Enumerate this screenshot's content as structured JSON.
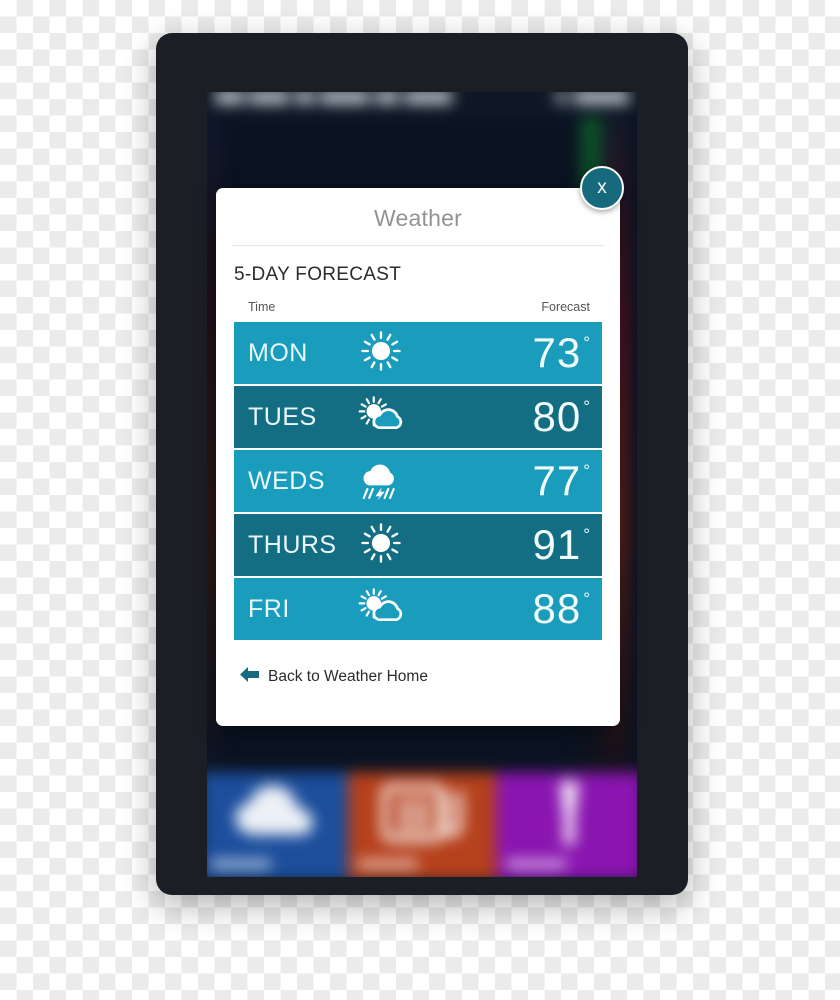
{
  "window": {
    "device_frame": "tablet-bezel",
    "bezel_color": "#1b1e25"
  },
  "background_app": {
    "description": "blurred weather application behind modal",
    "topbar_title_blurred": "",
    "topbar_time_blurred": "",
    "tiles": [
      {
        "name": "weather-tile",
        "color": "#1c4e9c",
        "icon": "cloud-icon",
        "label": ""
      },
      {
        "name": "news-tile",
        "color": "#b5401c",
        "icon": "building-icon",
        "label": ""
      },
      {
        "name": "media-tile",
        "color": "#8a15b0",
        "icon": "spotlight-icon",
        "label": ""
      }
    ]
  },
  "modal": {
    "title": "Weather",
    "section_title": "5-DAY FORECAST",
    "columns": {
      "time": "Time",
      "forecast": "Forecast"
    },
    "close_label": "x",
    "back_label": "Back to Weather Home",
    "accent_light": "#1a9cbd",
    "accent_dark": "#136e84",
    "close_bg": "#17697e",
    "arrow_color": "#17697e"
  },
  "forecast": [
    {
      "day": "MON",
      "icon": "sun-icon",
      "temp": "73",
      "degree": "°",
      "row_style": "light"
    },
    {
      "day": "TUES",
      "icon": "partly-cloudy-icon",
      "temp": "80",
      "degree": "°",
      "row_style": "dark"
    },
    {
      "day": "WEDS",
      "icon": "thunderstorm-icon",
      "temp": "77",
      "degree": "°",
      "row_style": "light"
    },
    {
      "day": "THURS",
      "icon": "sun-icon",
      "temp": "91",
      "degree": "°",
      "row_style": "dark"
    },
    {
      "day": "FRI",
      "icon": "partly-cloudy-icon",
      "temp": "88",
      "degree": "°",
      "row_style": "light"
    }
  ]
}
